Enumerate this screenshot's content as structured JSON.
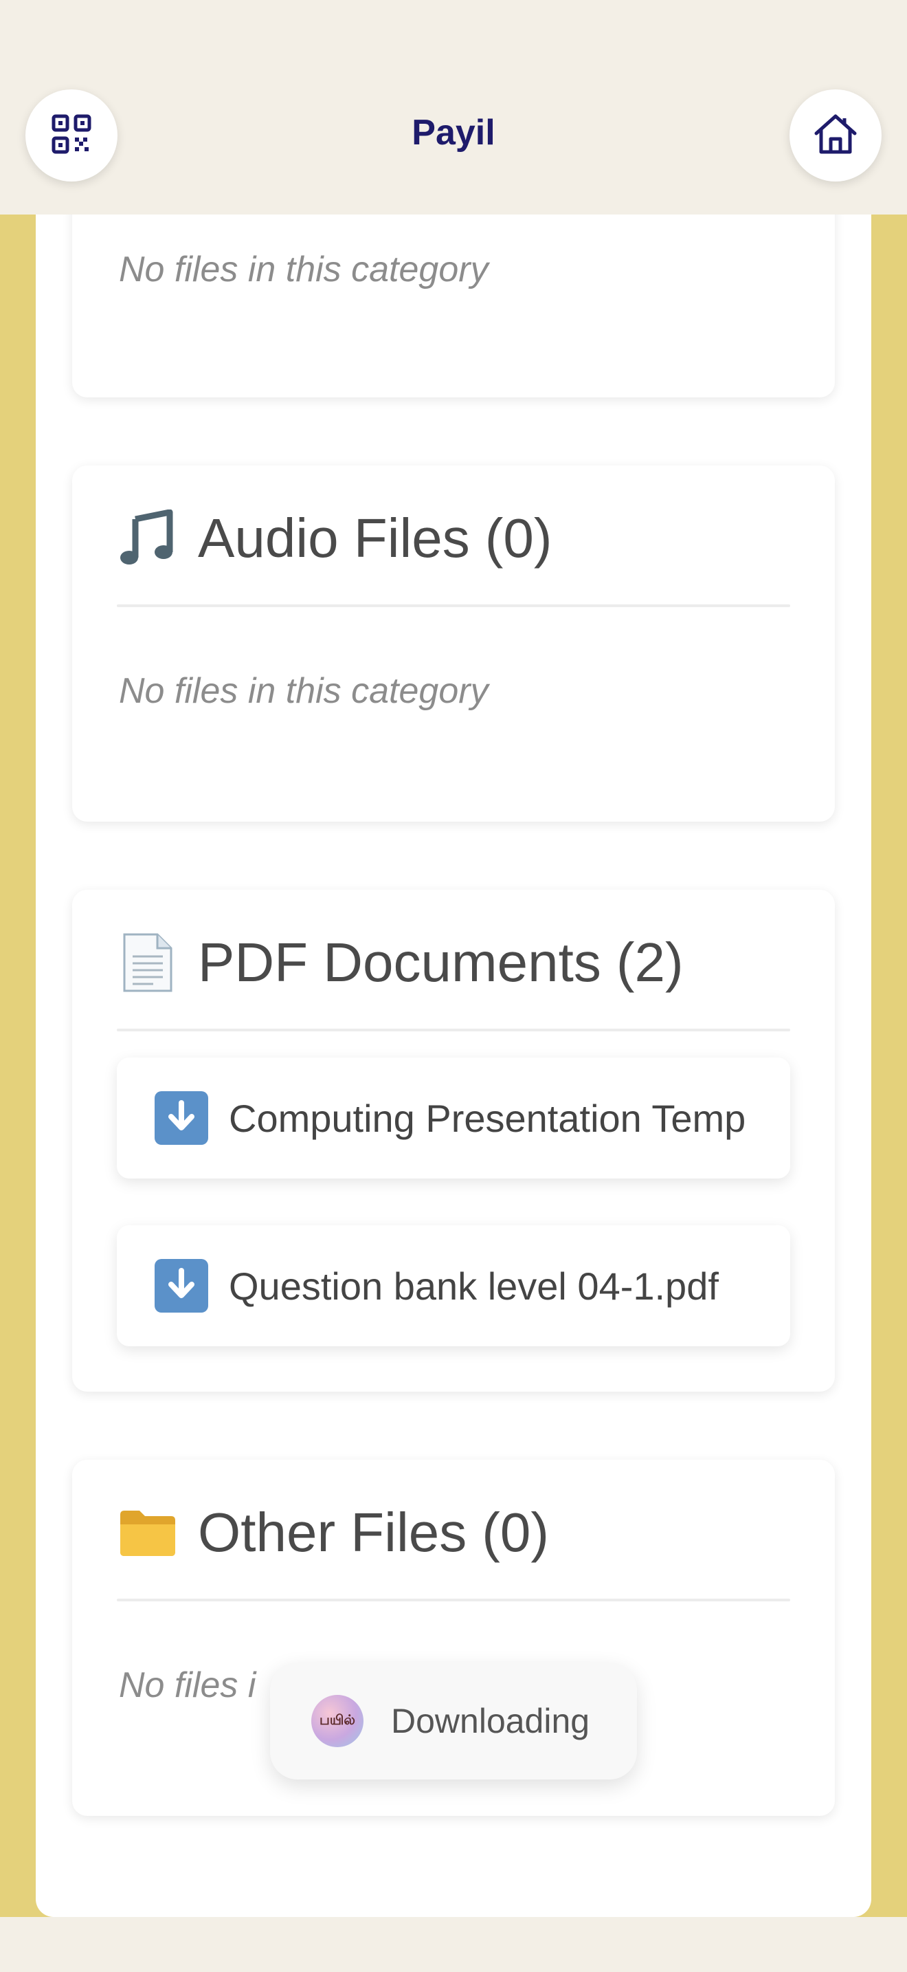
{
  "header": {
    "title": "Payil",
    "qr_icon": "qr-code-icon",
    "home_icon": "home-icon"
  },
  "empty_text": "No files in this category",
  "sections": [
    {
      "id": "top-partial",
      "empty_text": "No files in this category"
    },
    {
      "id": "audio",
      "icon": "music-note-icon",
      "title": "Audio Files",
      "count": "(0)",
      "empty_text": "No files in this category"
    },
    {
      "id": "pdf",
      "icon": "document-icon",
      "title": "PDF Documents",
      "count": "(2)",
      "files": [
        {
          "name": "Computing Presentation Temp",
          "icon": "download-arrow-icon"
        },
        {
          "name": "Question bank level 04-1.pdf",
          "icon": "download-arrow-icon"
        }
      ]
    },
    {
      "id": "other",
      "icon": "folder-icon",
      "title": "Other Files",
      "count": "(0)",
      "empty_text": "No files i"
    }
  ],
  "toast": {
    "logo_text": "பயில்",
    "text": "Downloading"
  },
  "colors": {
    "header_bg": "#f3efe6",
    "band": "#e4d17b",
    "title": "#1e1b6b",
    "download_icon": "#5b91c9"
  }
}
